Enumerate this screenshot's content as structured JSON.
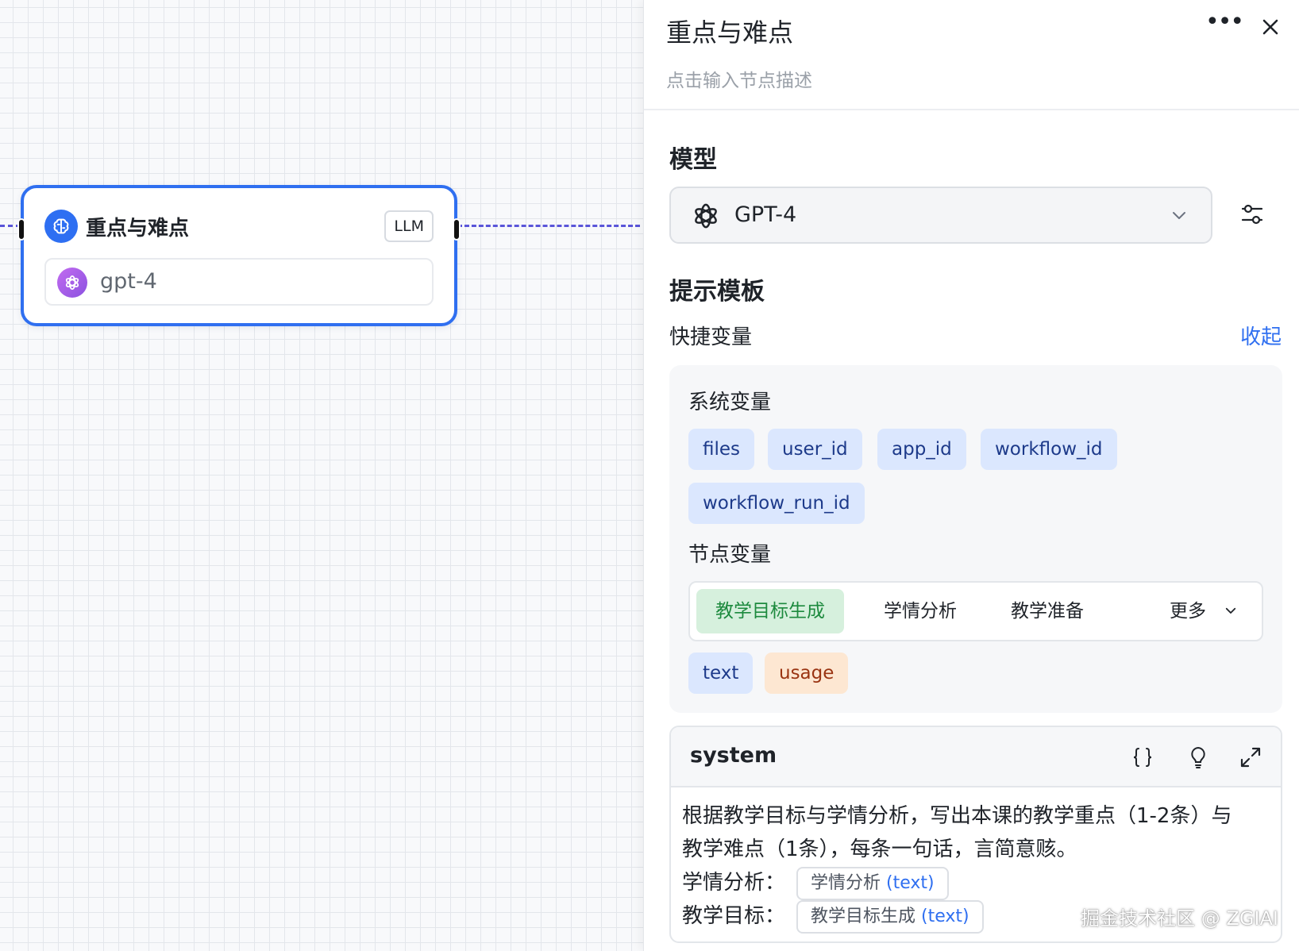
{
  "canvas": {
    "node": {
      "title": "重点与难点",
      "badge": "LLM",
      "model_name": "gpt-4",
      "icon": "brain-icon"
    }
  },
  "panel": {
    "title": "重点与难点",
    "description_placeholder": "点击输入节点描述",
    "model_section": "模型",
    "model_selected": "GPT-4",
    "prompt_section": "提示模板",
    "quick_vars_label": "快捷变量",
    "collapse_label": "收起",
    "system_vars_title": "系统变量",
    "system_vars": [
      "files",
      "user_id",
      "app_id",
      "workflow_id",
      "workflow_run_id"
    ],
    "node_vars_title": "节点变量",
    "node_tabs": [
      "教学目标生成",
      "学情分析",
      "教学准备",
      "更多"
    ],
    "node_outputs": [
      "text",
      "usage"
    ],
    "prompt": {
      "role": "system",
      "line1": "根据教学目标与学情分析，写出本课的教学重点（1-2条）与",
      "line2": "教学难点（1条），每条一句话，言简意赅。",
      "line3_label": "学情分析：",
      "line3_var": "学情分析",
      "line3_type": "(text)",
      "line4_label": "教学目标：",
      "line4_var": "教学目标生成",
      "line4_type": "(text)"
    }
  },
  "watermark": "掘金技术社区 @ ZGIAI",
  "colors": {
    "accent": "#2f6ff0",
    "edge": "#5a55d9",
    "chip_blue": "#dbe7fe",
    "chip_orange": "#fde7d2",
    "tab_active": "#d6f0dd"
  }
}
